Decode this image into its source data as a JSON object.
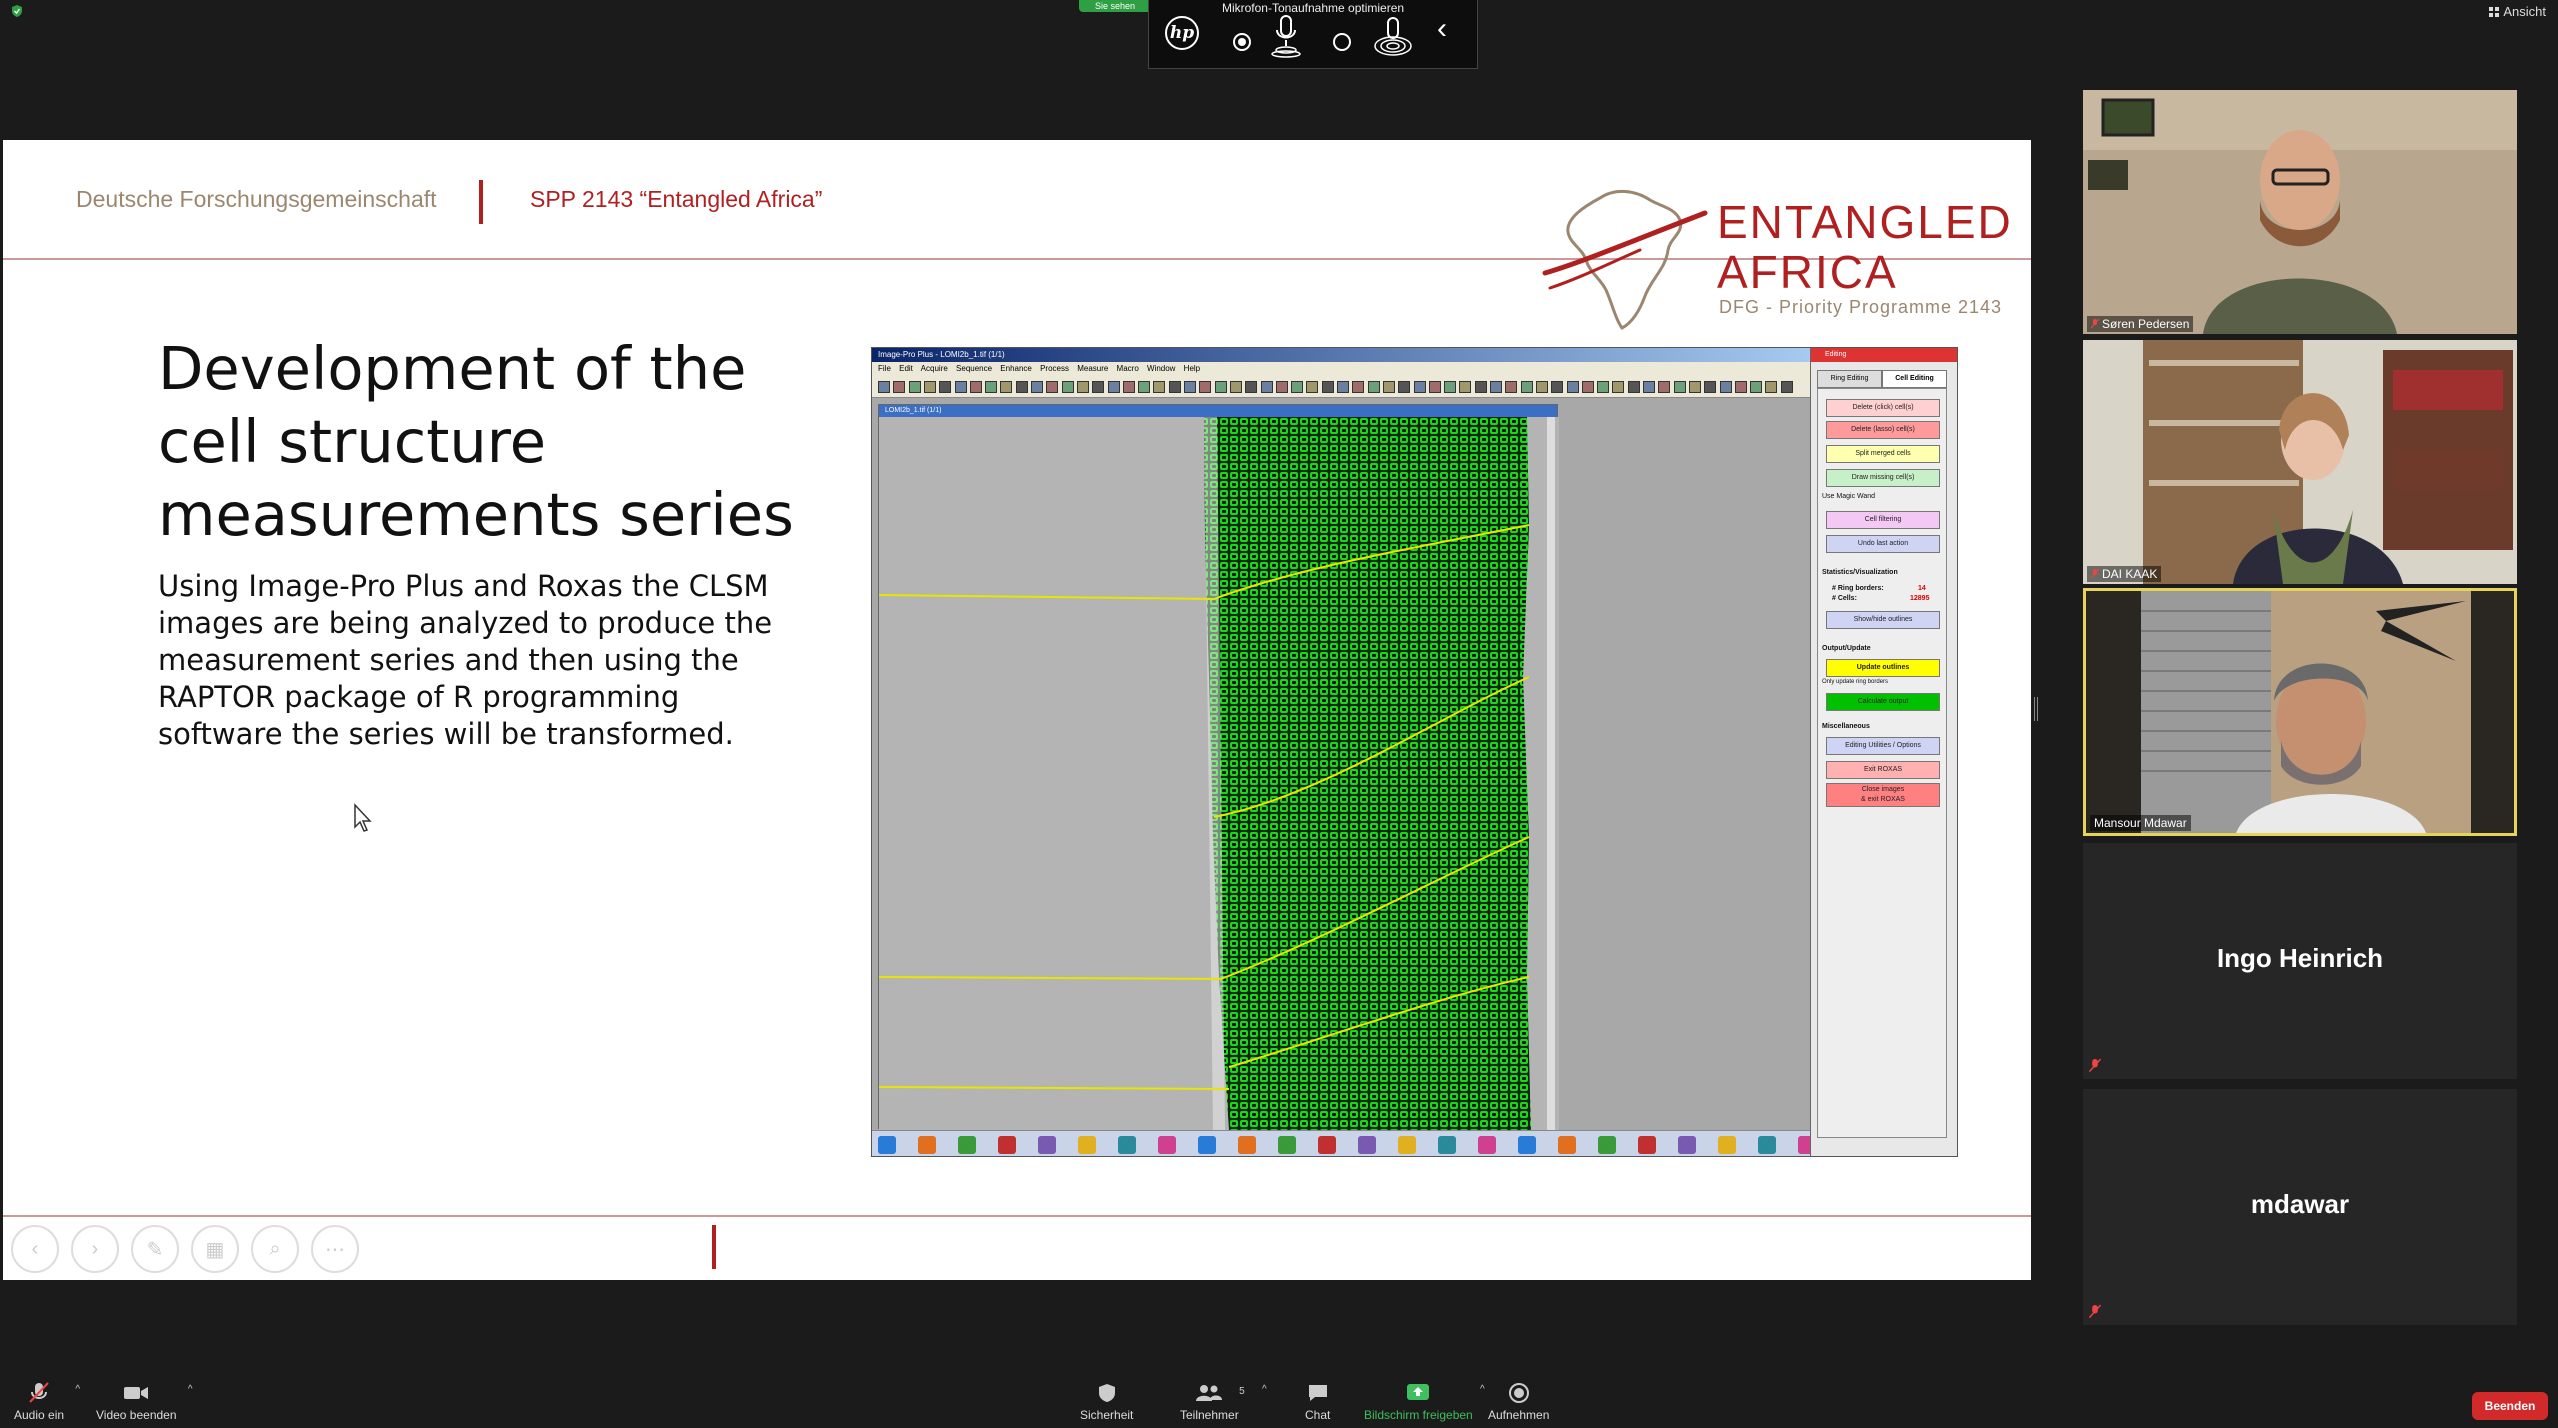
{
  "top": {
    "green_tab": "Sie sehen",
    "hp_caption": "Mikrofon-Tonaufnahme optimieren",
    "hp_logo": "hp",
    "view_label": "Ansicht"
  },
  "slide": {
    "header_left": "Deutsche Forschungsgemeinschaft",
    "header_right": "SPP 2143 “Entangled Africa”",
    "logo_line1": "ENTANGLED",
    "logo_line2": "AFRICA",
    "logo_line3": "DFG - Priority Programme 2143",
    "title": "Development of the cell structure measurements series",
    "body": "Using Image-Pro Plus and Roxas the CLSM images are being analyzed to produce the measurement series and then using the RAPTOR package of R programming software the series will be transformed.",
    "controls": [
      "prev-icon",
      "next-icon",
      "pen-icon",
      "slides-icon",
      "zoom-icon",
      "more-icon"
    ]
  },
  "screenshot": {
    "titlebar": "Image-Pro Plus - LOMI2b_1.tif (1/1)",
    "menubar": "File Edit Acquire Sequence Enhance Process Measure Macro Window Help",
    "image_window_title": "LOMI2b_1.tif (1/1)",
    "side_title": "Editing",
    "tab_ring": "Ring Editing",
    "tab_cell": "Cell Editing",
    "btn_delete_click": "Delete (click) cell(s)",
    "btn_delete_lasso": "Delete (lasso) cell(s)",
    "btn_split": "Split merged cells",
    "btn_draw": "Draw missing cell(s)",
    "chk_magic": "Use Magic Wand",
    "btn_filter": "Cell filtering",
    "btn_undo": "Undo last action",
    "lbl_stats": "Statistics/Visualization",
    "lbl_ring_borders": "# Ring borders:",
    "val_ring_borders": "14",
    "lbl_cells": "# Cells:",
    "val_cells": "12895",
    "btn_show_hide": "Show/hide outlines",
    "lbl_output": "Output/Update",
    "btn_update": "Update outlines",
    "chk_only_update": "Only update ring borders",
    "btn_calc": "Calculate output",
    "lbl_misc": "Miscellaneous",
    "btn_utilities": "Editing Utilities / Options",
    "btn_exit": "Exit ROXAS",
    "btn_close1": "Close images",
    "btn_close2": "& exit ROXAS"
  },
  "participants": [
    {
      "name": "Søren Pedersen"
    },
    {
      "name": "DAI KAAK"
    },
    {
      "name": "Mansour Mdawar"
    },
    {
      "name": "Ingo Heinrich"
    },
    {
      "name": "mdawar"
    }
  ],
  "bottom": {
    "audio": "Audio ein",
    "video": "Video beenden",
    "security": "Sicherheit",
    "participants": "Teilnehmer",
    "participants_count": "5",
    "chat": "Chat",
    "share": "Bildschirm freigeben",
    "record": "Aufnehmen",
    "end": "Beenden"
  },
  "colors": {
    "brand_red": "#b02020",
    "share_green": "#3fbf5f",
    "active_speaker": "#e6d45a",
    "end_red": "#d22a2a"
  }
}
